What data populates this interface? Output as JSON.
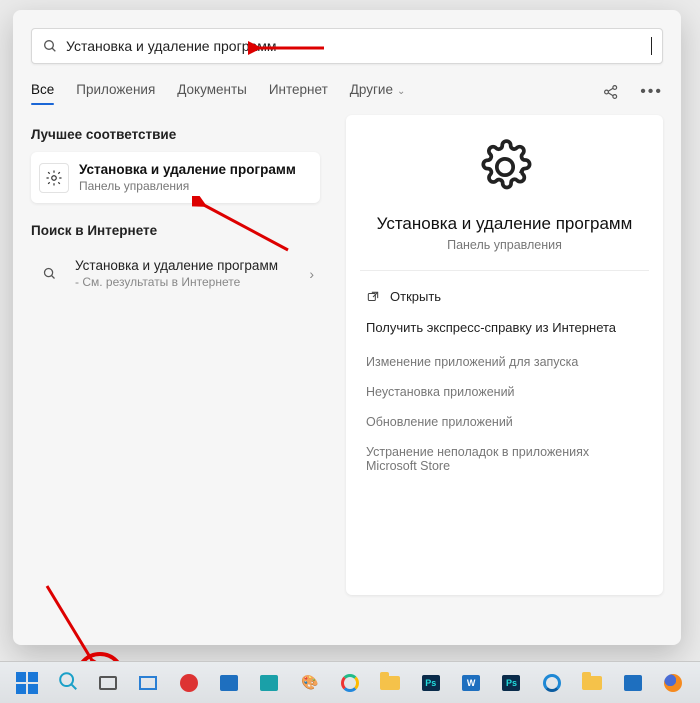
{
  "search": {
    "value": "Установка и удаление программ"
  },
  "tabs": {
    "all": "Все",
    "apps": "Приложения",
    "docs": "Документы",
    "web": "Интернет",
    "more": "Другие"
  },
  "left": {
    "best_match_label": "Лучшее соответствие",
    "best_match": {
      "title": "Установка и удаление программ",
      "subtitle": "Панель управления"
    },
    "search_web_label": "Поиск в Интернете",
    "web_result": {
      "title": "Установка и удаление программ",
      "subtitle": "- См. результаты в Интернете"
    }
  },
  "detail": {
    "title": "Установка и удаление программ",
    "subtitle": "Панель управления",
    "open": "Открыть",
    "help_heading": "Получить экспресс-справку из Интернета",
    "links": [
      "Изменение приложений для запуска",
      "Неустановка приложений",
      "Обновление приложений",
      "Устранение неполадок в приложениях Microsoft Store"
    ]
  }
}
